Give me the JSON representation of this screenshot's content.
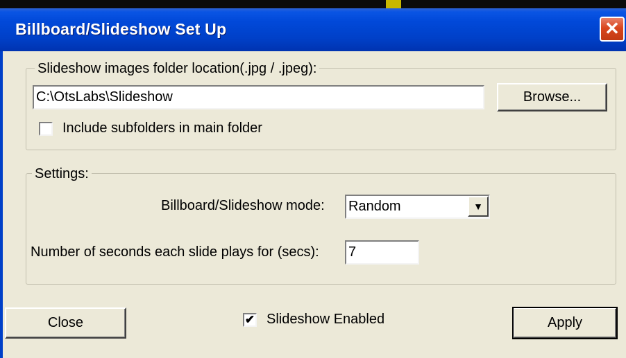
{
  "window": {
    "title": "Billboard/Slideshow Set Up",
    "close_glyph": "✕"
  },
  "folder_group": {
    "legend": "Slideshow images folder location(.jpg / .jpeg):",
    "path_value": "C:\\OtsLabs\\Slideshow",
    "browse_label": "Browse...",
    "include_subfolders": {
      "label": "Include subfolders in main folder",
      "checked": false
    }
  },
  "settings_group": {
    "legend": "Settings:",
    "mode_label": "Billboard/Slideshow mode:",
    "mode_value": "Random",
    "seconds_label": "Number of seconds each slide plays for (secs):",
    "seconds_value": "7"
  },
  "footer": {
    "close_label": "Close",
    "slideshow_enabled": {
      "label": "Slideshow Enabled",
      "checked": true,
      "check_glyph": "✔"
    },
    "apply_label": "Apply"
  },
  "icons": {
    "dropdown_arrow": "▼"
  }
}
